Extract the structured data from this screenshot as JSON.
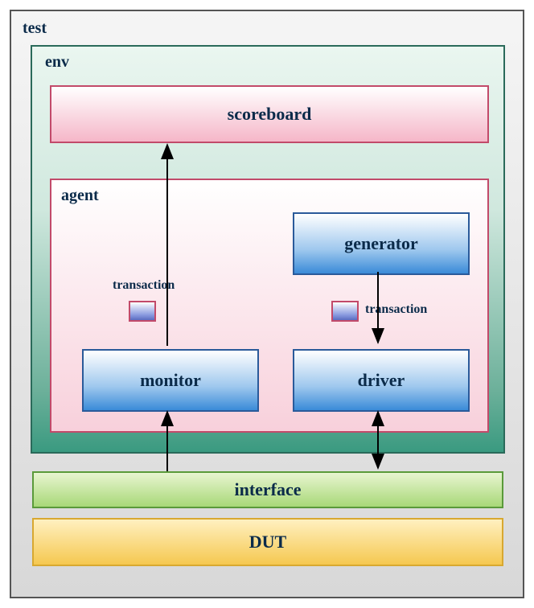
{
  "test": {
    "label": "test"
  },
  "env": {
    "label": "env"
  },
  "scoreboard": {
    "label": "scoreboard"
  },
  "agent": {
    "label": "agent"
  },
  "generator": {
    "label": "generator"
  },
  "monitor": {
    "label": "monitor"
  },
  "driver": {
    "label": "driver"
  },
  "transaction1": {
    "label": "transaction"
  },
  "transaction2": {
    "label": "transaction"
  },
  "interface": {
    "label": "interface"
  },
  "dut": {
    "label": "DUT"
  }
}
